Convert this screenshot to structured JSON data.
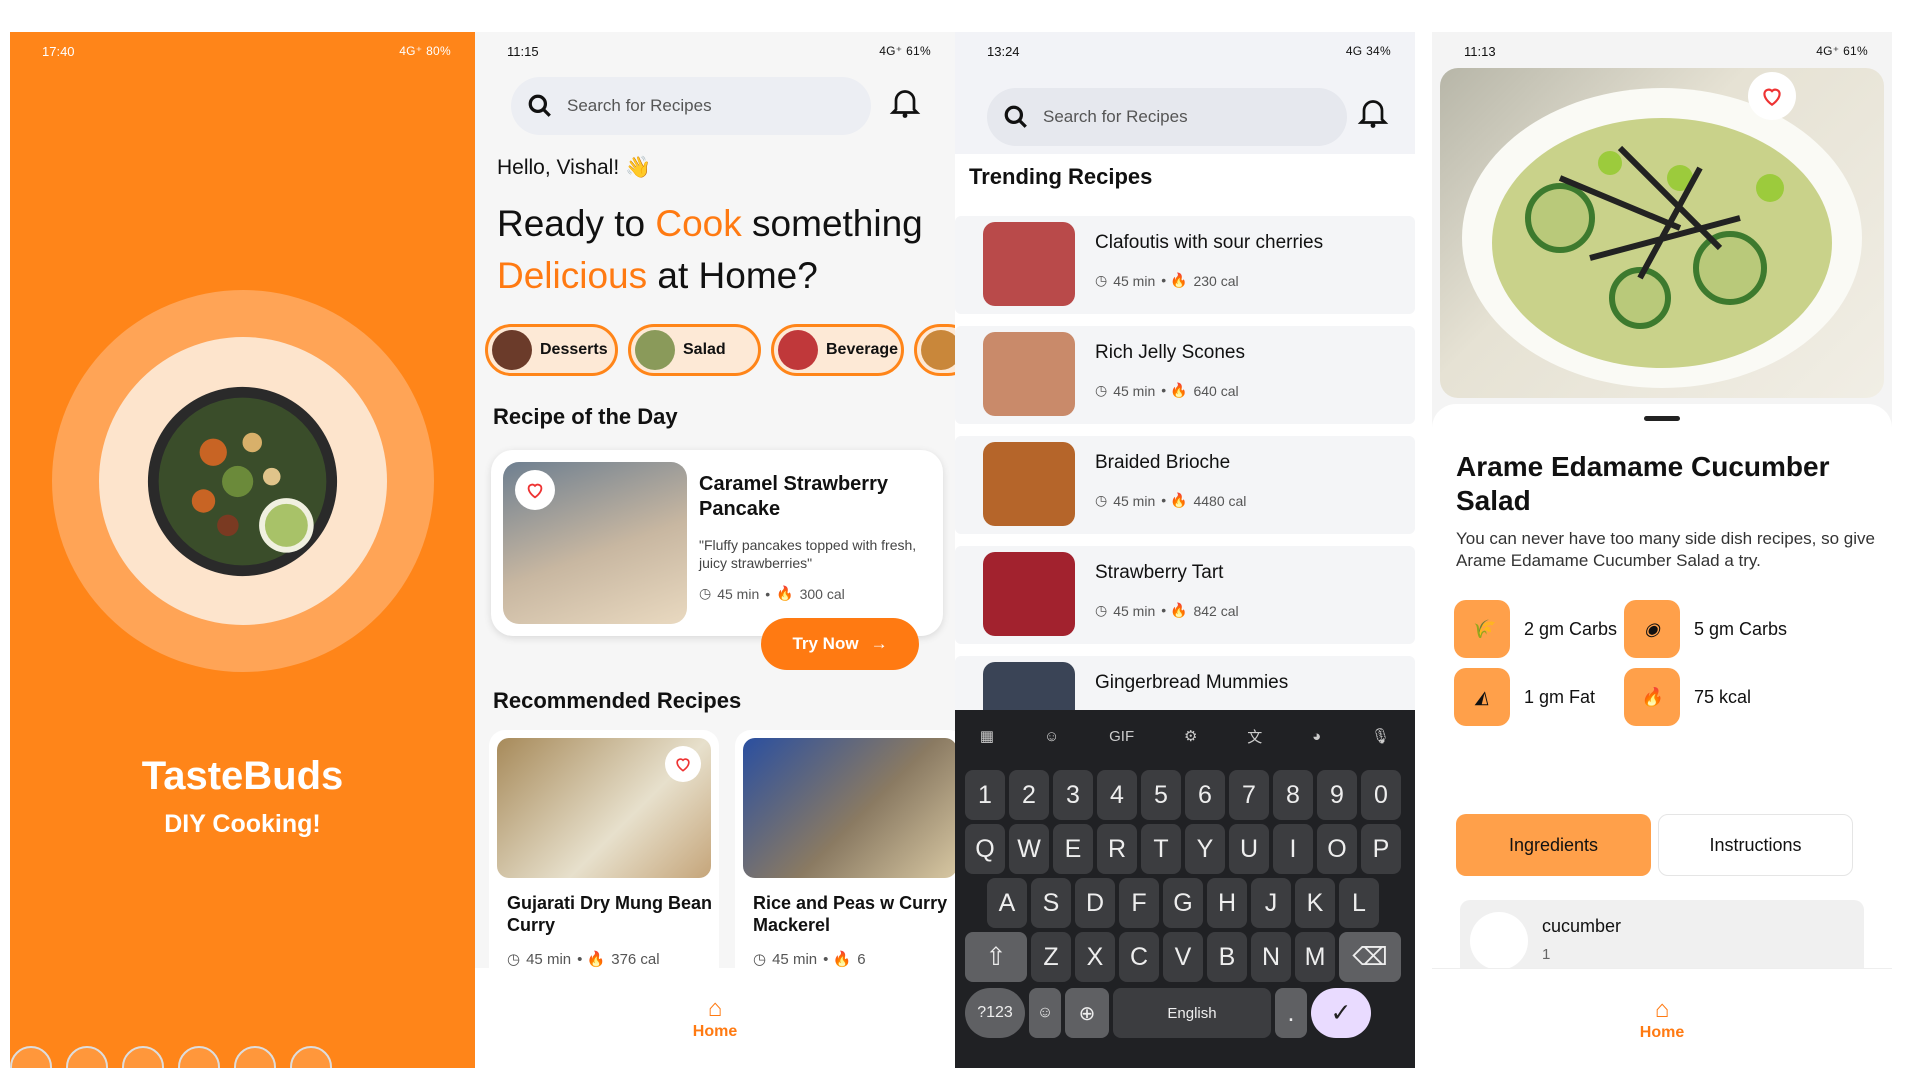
{
  "splash": {
    "status_time": "17:40",
    "status_right": "4G⁺ 80%",
    "brand": "TasteBuds",
    "slogan": "DIY Cooking!"
  },
  "home": {
    "status_time": "11:15",
    "status_right": "4G⁺ 61%",
    "search_placeholder": "Search for Recipes",
    "greeting": "Hello, Vishal! 👋",
    "headline_1": "Ready to ",
    "headline_cook": "Cook",
    "headline_2": " something",
    "headline_delicious": "Delicious",
    "headline_3": " at Home?",
    "categories": [
      "Desserts",
      "Salad",
      "Beverage"
    ],
    "recipe_of_day_heading": "Recipe of the Day",
    "rod": {
      "title": "Caramel Strawberry Pancake",
      "desc": "\"Fluffy pancakes topped with fresh, juicy strawberries\"",
      "time": "45 min",
      "cal": "300 cal",
      "cta": "Try Now"
    },
    "recommended_heading": "Recommended Recipes",
    "recommended": [
      {
        "title": "Gujarati Dry Mung Bean Curry",
        "time": "45 min",
        "cal": "376 cal"
      },
      {
        "title": "Rice and Peas w Curry Mackerel",
        "time": "45 min",
        "cal": "6"
      }
    ],
    "nav_home": "Home"
  },
  "trending": {
    "status_time": "13:24",
    "status_right": "4G 34%",
    "search_placeholder": "Search for Recipes",
    "heading": "Trending Recipes",
    "items": [
      {
        "title": "Clafoutis with sour cherries",
        "time": "45 min",
        "cal": "230 cal"
      },
      {
        "title": "Rich Jelly Scones",
        "time": "45 min",
        "cal": "640 cal"
      },
      {
        "title": "Braided Brioche",
        "time": "45 min",
        "cal": "4480 cal"
      },
      {
        "title": "Strawberry Tart",
        "time": "45 min",
        "cal": "842 cal"
      },
      {
        "title": "Gingerbread Mummies",
        "time": "",
        "cal": ""
      }
    ],
    "keyboard": {
      "row1": [
        "1",
        "2",
        "3",
        "4",
        "5",
        "6",
        "7",
        "8",
        "9",
        "0"
      ],
      "row2": [
        "Q",
        "W",
        "E",
        "R",
        "T",
        "Y",
        "U",
        "I",
        "O",
        "P"
      ],
      "row3": [
        "A",
        "S",
        "D",
        "F",
        "G",
        "H",
        "J",
        "K",
        "L"
      ],
      "row4": [
        "Z",
        "X",
        "C",
        "V",
        "B",
        "N",
        "M"
      ],
      "sym": "?123",
      "space": "English",
      "dot": ".",
      "gif": "GIF"
    }
  },
  "detail": {
    "status_time": "11:13",
    "status_right": "4G⁺ 61%",
    "title": "Arame Edamame Cucumber Salad",
    "desc": "You can never have too many side dish recipes, so give Arame Edamame Cucumber Salad a try.",
    "stats": [
      "2 gm Carbs",
      "5 gm Carbs",
      "1 gm Fat",
      "75 kcal"
    ],
    "tab_ingredients": "Ingredients",
    "tab_instructions": "Instructions",
    "ingredient": {
      "name": "cucumber",
      "qty": "1"
    },
    "nav_home": "Home"
  },
  "colors": {
    "accent": "#ff7a12",
    "splash_bg": "#ff8519"
  }
}
